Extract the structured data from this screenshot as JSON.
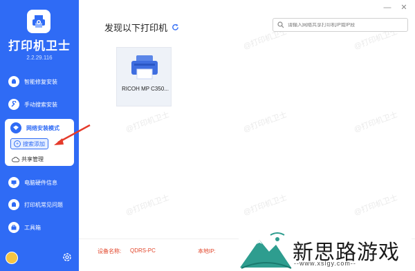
{
  "app": {
    "name": "打印机卫士",
    "version": "2.2.29.116"
  },
  "sidebar": {
    "items": [
      {
        "label": "智能修复安装",
        "icon": "repair-icon"
      },
      {
        "label": "手动搜索安装",
        "icon": "wrench-icon"
      },
      {
        "label": "网络安装模式",
        "icon": "network-icon"
      },
      {
        "label": "电脑硬件信息",
        "icon": "hardware-icon"
      },
      {
        "label": "打印机常见问题",
        "icon": "question-icon"
      },
      {
        "label": "工具箱",
        "icon": "toolbox-icon"
      }
    ],
    "network_sub": [
      {
        "label": "搜索添加",
        "icon": "search-add-icon",
        "active": true
      },
      {
        "label": "共享管理",
        "icon": "cloud-icon",
        "active": false
      }
    ]
  },
  "main": {
    "heading": "发现以下打印机",
    "search": {
      "placeholder": "请输入网络共享打印机IP或IP段"
    },
    "printers": [
      {
        "name": "RICOH MP C350..."
      }
    ]
  },
  "footer": {
    "device_label": "设备名称:",
    "device_value": "QDRS-PC",
    "ip_label": "本地IP:"
  },
  "watermark": "@打印机卫士",
  "site_logo": {
    "text": "新思路游戏",
    "url": "--www.xslgy.com--"
  },
  "colors": {
    "brand": "#2f6bf5",
    "accent_red": "#e2462b"
  }
}
